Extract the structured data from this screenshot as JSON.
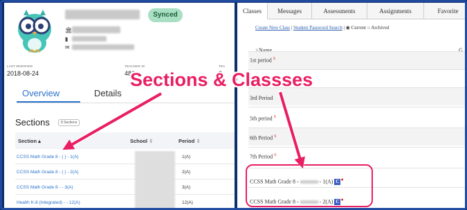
{
  "annotation": {
    "headline": "Sections & Classses",
    "accent": "#e91e63"
  },
  "profile": {
    "status_badge": "Synced",
    "last_modified_label": "LAST MODIFIED",
    "last_modified_value": "2018-08-24",
    "teacher_id_label": "TEACHER ID",
    "teacher_id_value": "486",
    "third_label": "TEA",
    "third_value": "2"
  },
  "tabs": {
    "overview": "Overview",
    "details": "Details"
  },
  "sections": {
    "title": "Sections",
    "count": "8 Sections",
    "headers": {
      "section": "Section",
      "school": "School",
      "period": "Period"
    },
    "rows": [
      {
        "section": "CCSS Math Grade 8 - (      ) - 1(A)",
        "period": "1(A)"
      },
      {
        "section": "CCSS Math Grade 8 - (      ) - 2(A)",
        "period": "2(A)"
      },
      {
        "section": "CCSS Math Grade 8 -         - 3(A)",
        "period": "3(A)"
      },
      {
        "section": "Health K-8 (Integrated) -         - 12(A)",
        "period": "12(A)"
      }
    ]
  },
  "right_tabs": [
    "Classes",
    "Messages",
    "Assessments",
    "Assignments",
    "Favorite"
  ],
  "class_links": {
    "create": "Create New Class",
    "sep": "|",
    "password": "Student Password Search",
    "sep2": "|",
    "current": "Current",
    "archived": "Archived"
  },
  "class_list": {
    "name_header": "Name",
    "g_header": "G",
    "rows": [
      {
        "name": "1st period"
      },
      {
        "name": ""
      },
      {
        "name": "3rd Period"
      },
      {
        "name": "5th period"
      },
      {
        "name": "6th Period"
      },
      {
        "name": "7th Period"
      },
      {
        "name": "CCSS Math Grade 8 - ",
        "suffix": " - 1(A)"
      },
      {
        "name": "CCSS Math Grade 8 - ",
        "suffix": " - 2(A)"
      }
    ],
    "s_mark": "S",
    "c_badge": "C",
    "dot": "●"
  }
}
